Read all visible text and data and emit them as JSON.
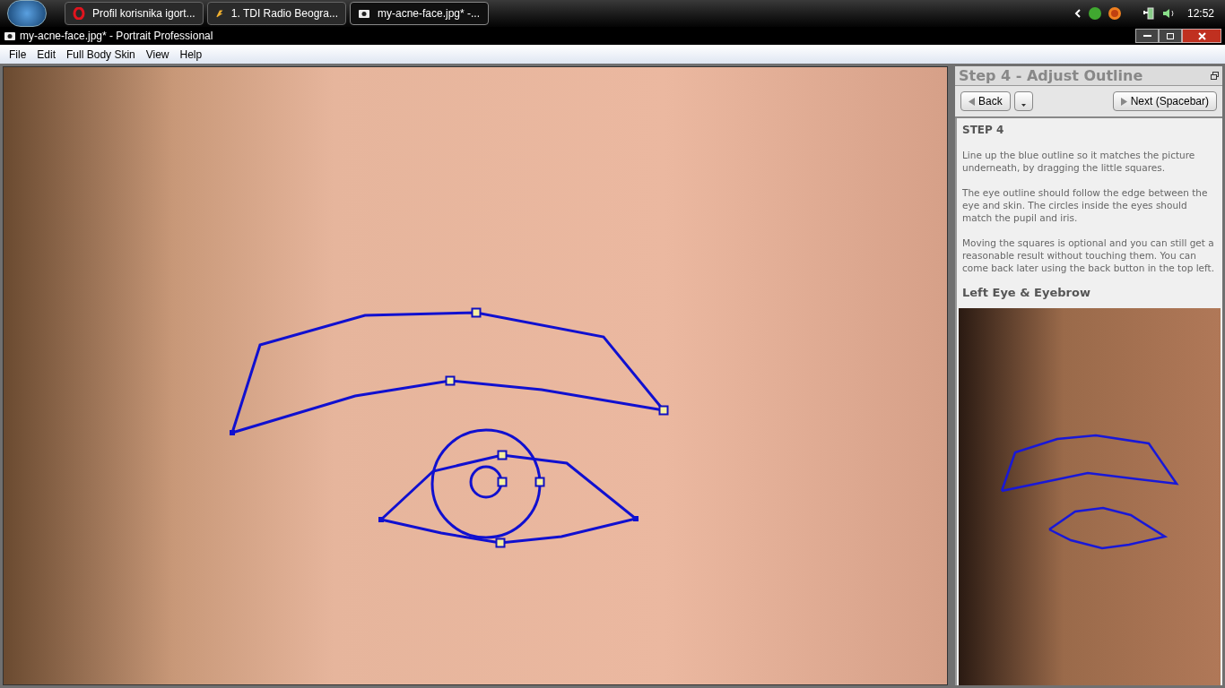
{
  "taskbar": {
    "tasks": [
      {
        "label": "Profil korisnika igort...",
        "selected": false,
        "kind": "browser"
      },
      {
        "label": "1. TDI Radio Beogra...",
        "selected": false,
        "kind": "player"
      },
      {
        "label": "my-acne-face.jpg* -...",
        "selected": true,
        "kind": "camera"
      }
    ],
    "clock": "12:52"
  },
  "window": {
    "title": "my-acne-face.jpg* - Portrait Professional"
  },
  "menu": [
    "File",
    "Edit",
    "Full Body Skin",
    "View",
    "Help"
  ],
  "panel": {
    "title": "Step 4 - Adjust Outline",
    "back": "Back",
    "next": "Next (Spacebar)",
    "heading": "STEP 4",
    "paragraphs": [
      "Line up the blue outline so it matches the picture underneath, by dragging the little squares.",
      "The eye outline should follow the edge between the eye and skin. The circles inside the eyes should match the pupil and iris.",
      "Moving the squares is optional and you can still get a reasonable result without touching them.  You can come back later using the back button in the top left."
    ],
    "subheading": "Left Eye & Eyebrow"
  }
}
